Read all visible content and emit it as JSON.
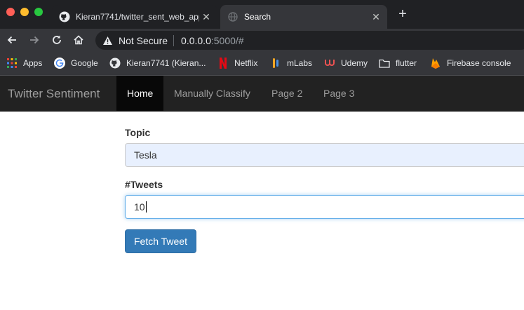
{
  "browser": {
    "tabs": [
      {
        "title": "Kieran7741/twitter_sent_web_app",
        "icon": "github-icon",
        "close": "✕"
      },
      {
        "title": "Search",
        "icon": "globe-icon",
        "close": "✕"
      }
    ],
    "new_tab": "+",
    "address": {
      "security_label": "Not Secure",
      "host": "0.0.0.0",
      "path": ":5000/#"
    },
    "bookmarks": [
      {
        "label": "Apps",
        "icon": "apps-grid-icon"
      },
      {
        "label": "Google",
        "icon": "google-icon"
      },
      {
        "label": "Kieran7741 (Kieran...",
        "icon": "github-icon"
      },
      {
        "label": "Netflix",
        "icon": "netflix-icon"
      },
      {
        "label": "mLabs",
        "icon": "mlab-icon"
      },
      {
        "label": "Udemy",
        "icon": "udemy-icon"
      },
      {
        "label": "flutter",
        "icon": "folder-icon"
      },
      {
        "label": "Firebase console",
        "icon": "firebase-icon"
      }
    ]
  },
  "navbar": {
    "brand": "Twitter Sentiment",
    "links": [
      {
        "label": "Home",
        "active": true
      },
      {
        "label": "Manually Classify",
        "active": false
      },
      {
        "label": "Page 2",
        "active": false
      },
      {
        "label": "Page 3",
        "active": false
      }
    ]
  },
  "form": {
    "topic_label": "Topic",
    "topic_value": "Tesla",
    "tweets_label": "#Tweets",
    "tweets_value": "10",
    "submit_label": "Fetch Tweet"
  },
  "colors": {
    "navbar_bg": "#222222",
    "button_primary": "#337ab7",
    "autofill_bg": "#e8f0fe"
  }
}
